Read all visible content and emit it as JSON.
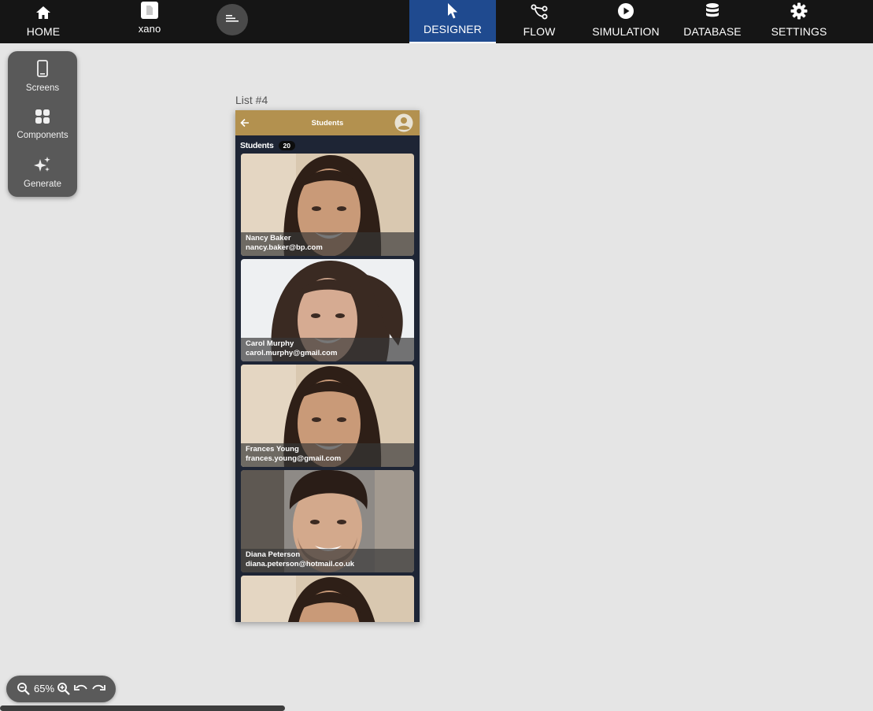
{
  "nav": {
    "home": "HOME",
    "project": "xano",
    "designer": "DESIGNER",
    "flow": "FLOW",
    "simulation": "SIMULATION",
    "database": "DATABASE",
    "settings": "SETTINGS"
  },
  "tools": {
    "screens": "Screens",
    "components": "Components",
    "generate": "Generate"
  },
  "canvas": {
    "screen_label": "List #4"
  },
  "app": {
    "header_title": "Students",
    "list_title": "Students",
    "list_count": "20",
    "students": [
      {
        "name": "Nancy Baker",
        "email": "nancy.baker@bp.com"
      },
      {
        "name": "Carol Murphy",
        "email": "carol.murphy@gmail.com"
      },
      {
        "name": "Frances Young",
        "email": "frances.young@gmail.com"
      },
      {
        "name": "Diana Peterson",
        "email": "diana.peterson@hotmail.co.uk"
      }
    ]
  },
  "zoom": {
    "level": "65%"
  },
  "colors": {
    "topbar": "#151515",
    "active_tab": "#1f4a8f",
    "app_header": "#b3914f",
    "app_background": "#1e2535",
    "panel": "#595959"
  }
}
